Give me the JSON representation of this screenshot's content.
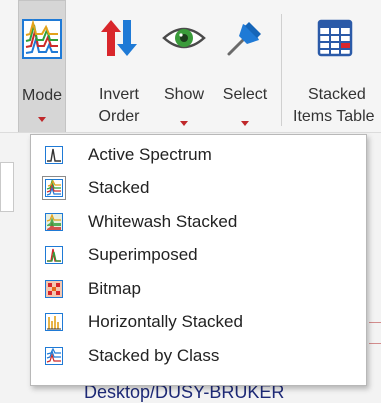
{
  "ribbon": {
    "buttons": [
      {
        "id": "mode",
        "label_lines": [
          "Mode"
        ],
        "has_dropdown": true
      },
      {
        "id": "invert",
        "label_lines": [
          "Invert",
          "Order"
        ],
        "has_dropdown": false
      },
      {
        "id": "show",
        "label_lines": [
          "Show"
        ],
        "has_dropdown": true
      },
      {
        "id": "select",
        "label_lines": [
          "Select"
        ],
        "has_dropdown": true
      },
      {
        "id": "stacked-table",
        "label_lines": [
          "Stacked",
          "Items Table"
        ],
        "has_dropdown": false
      }
    ]
  },
  "menu": {
    "items": [
      {
        "label": "Active Spectrum",
        "icon": "active-spectrum-icon",
        "selected": false
      },
      {
        "label": "Stacked",
        "icon": "stacked-icon",
        "selected": true
      },
      {
        "label": "Whitewash Stacked",
        "icon": "whitewash-stacked-icon",
        "selected": false
      },
      {
        "label": "Superimposed",
        "icon": "superimposed-icon",
        "selected": false
      },
      {
        "label": "Bitmap",
        "icon": "bitmap-icon",
        "selected": false
      },
      {
        "label": "Horizontally Stacked",
        "icon": "horizontally-stacked-icon",
        "selected": false
      },
      {
        "label": "Stacked by Class",
        "icon": "stacked-by-class-icon",
        "selected": false
      }
    ]
  },
  "background": {
    "partial_path_text": "Desktop/DUSY-BRUKER"
  },
  "colors": {
    "accent_red": "#c0282b",
    "accent_blue": "#1f7ad6",
    "menu_selected_bg": "#e3e3e3"
  }
}
